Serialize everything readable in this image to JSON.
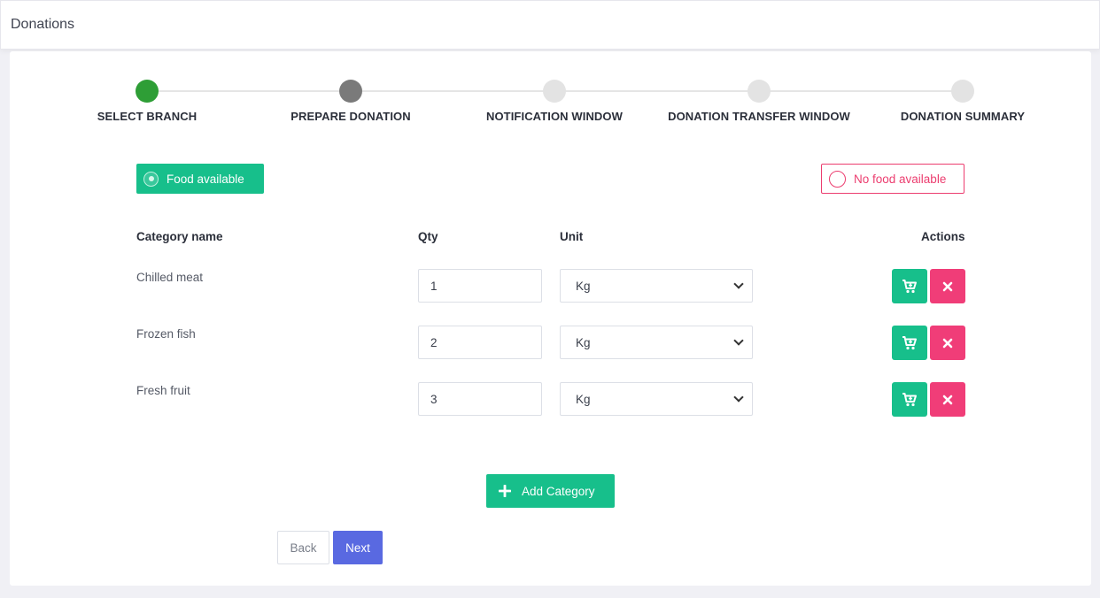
{
  "header": {
    "title": "Donations"
  },
  "stepper": {
    "steps": [
      {
        "label": "SELECT BRANCH",
        "state": "complete",
        "color": "#2e9e36"
      },
      {
        "label": "PREPARE DONATION",
        "state": "current",
        "color": "#7a7a7a"
      },
      {
        "label": "NOTIFICATION WINDOW",
        "state": "pending",
        "color": "#e3e3e3"
      },
      {
        "label": "DONATION TRANSFER WINDOW",
        "state": "pending",
        "color": "#e3e3e3"
      },
      {
        "label": "DONATION SUMMARY",
        "state": "pending",
        "color": "#e3e3e3"
      }
    ]
  },
  "availability": {
    "food_available_label": "Food available",
    "no_food_available_label": "No food available",
    "selected": "food_available"
  },
  "table": {
    "headers": {
      "category": "Category name",
      "qty": "Qty",
      "unit": "Unit",
      "actions": "Actions"
    },
    "rows": [
      {
        "category": "Chilled meat",
        "qty": "1",
        "unit": "Kg"
      },
      {
        "category": "Frozen fish",
        "qty": "2",
        "unit": "Kg"
      },
      {
        "category": "Fresh fruit",
        "qty": "3",
        "unit": "Kg"
      }
    ]
  },
  "buttons": {
    "add_category": "Add Category",
    "back": "Back",
    "next": "Next"
  },
  "colors": {
    "accent_green": "#17bf8b",
    "danger_pink": "#f03d78",
    "primary_blue": "#5969e1"
  },
  "icons": {
    "row_action_1": "cart-plus-icon",
    "row_action_2": "close-icon",
    "add": "plus-icon"
  }
}
